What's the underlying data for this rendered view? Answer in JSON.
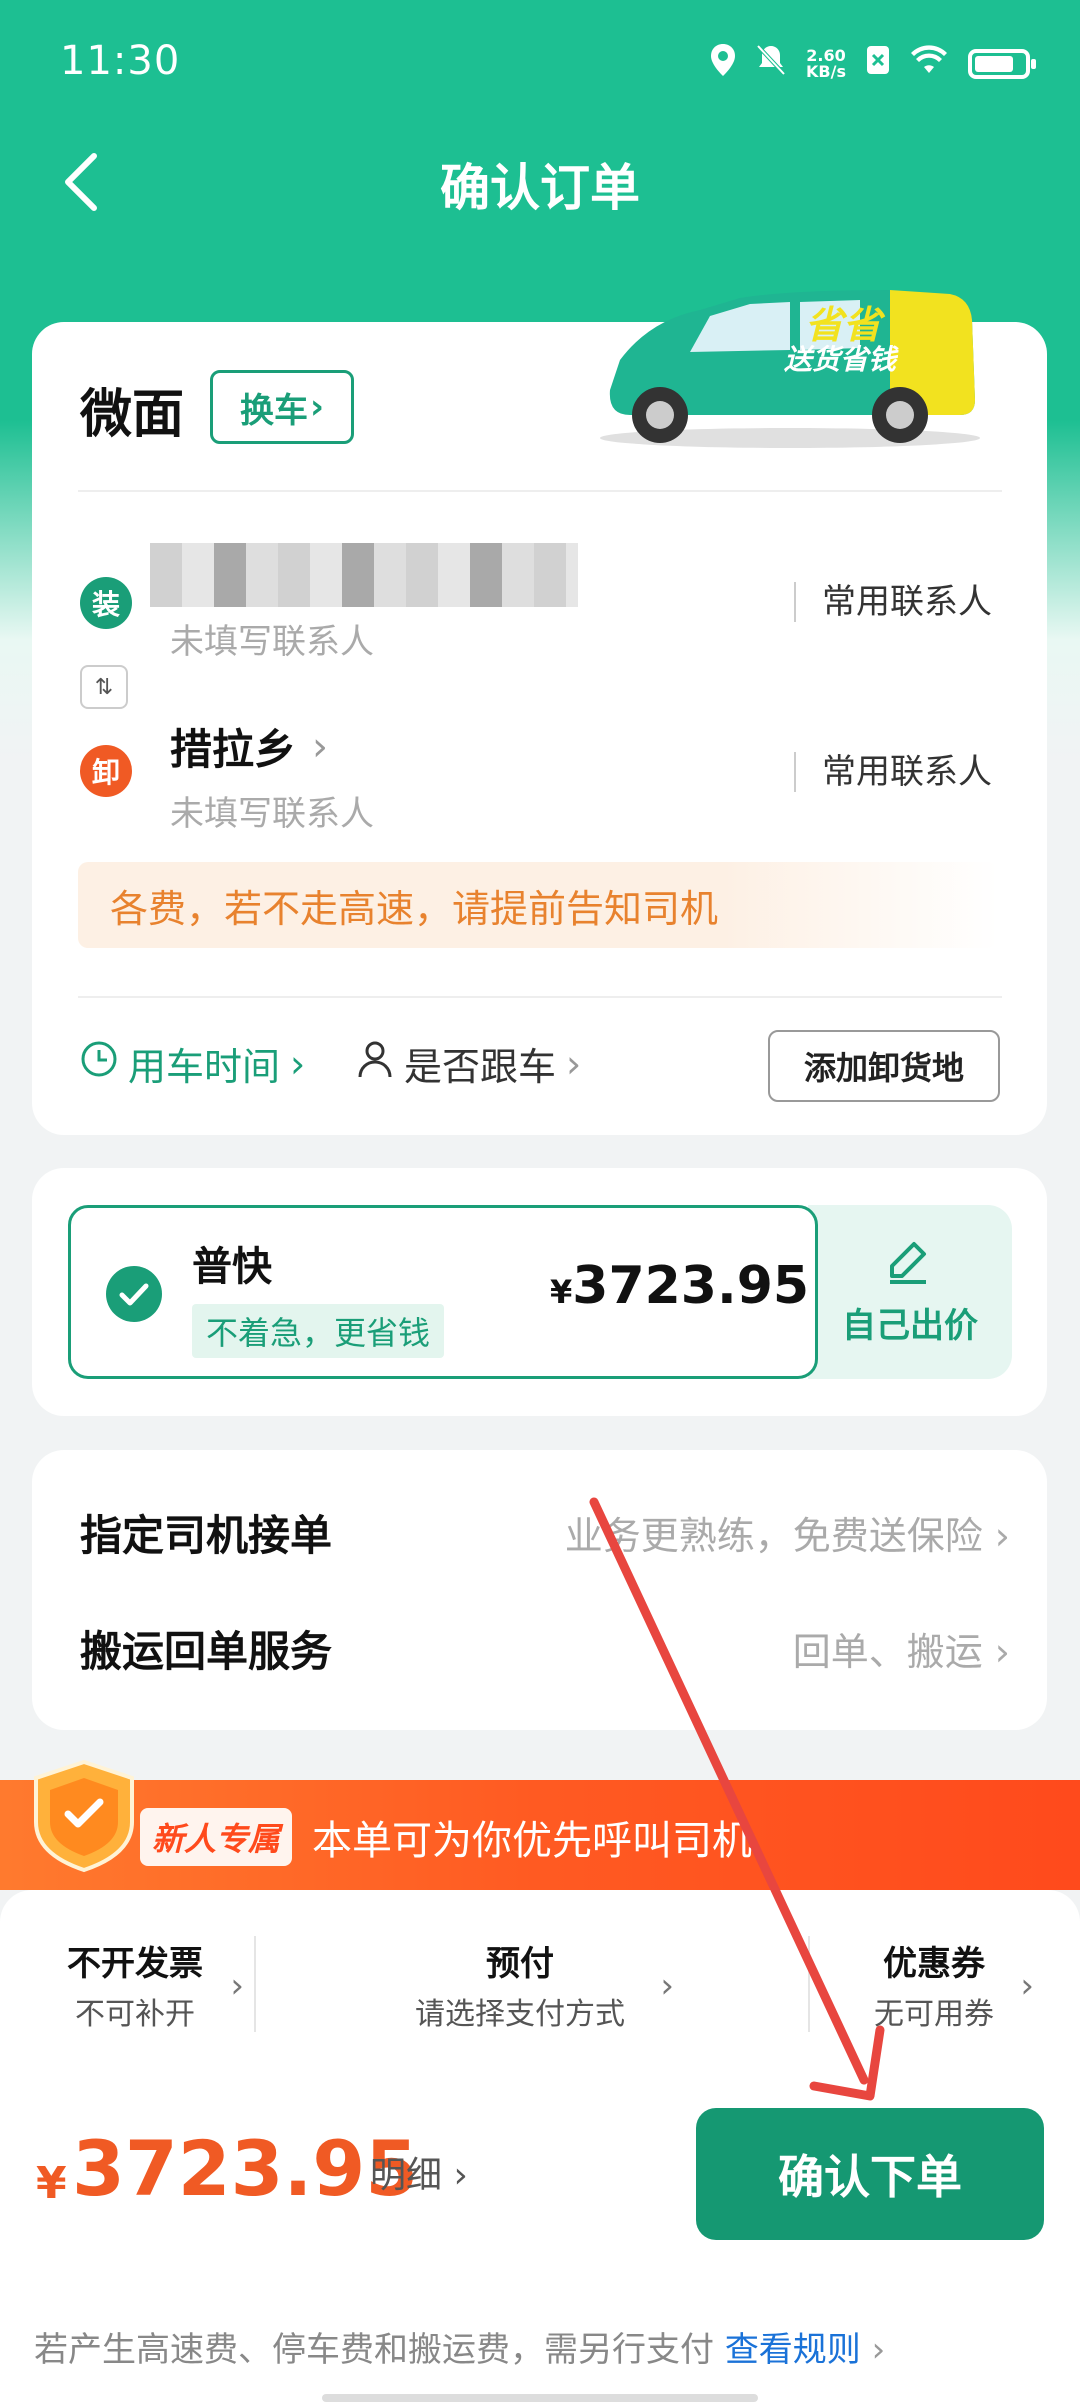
{
  "status_bar": {
    "time": "11:30",
    "net_speed_value": "2.60",
    "net_speed_unit": "KB/s"
  },
  "header": {
    "title": "确认订单"
  },
  "vehicle": {
    "name": "微面",
    "change_label": "换车",
    "promo_img_line1": "省省",
    "promo_img_line2": "送货省钱"
  },
  "route": {
    "load_pin": "装",
    "unload_pin": "卸",
    "load_contact_hint": "未填写联系人",
    "load_contact_link": "常用联系人",
    "unload_address": "措拉乡",
    "unload_contact_hint": "未填写联系人",
    "unload_contact_link": "常用联系人",
    "notice": "各费，若不走高速，请提前告知司机"
  },
  "options": {
    "use_time": "用车时间",
    "follow_car": "是否跟车",
    "add_unload": "添加卸货地"
  },
  "pricing": {
    "fast_name": "普快",
    "fast_tag": "不着急，更省钱",
    "currency": "¥",
    "fast_price": "3723.95",
    "bid_label": "自己出价"
  },
  "services": {
    "assign_driver_title": "指定司机接单",
    "assign_driver_value": "业务更熟练，免费送保险",
    "receipt_title": "搬运回单服务",
    "receipt_value": "回单、搬运"
  },
  "promo": {
    "tag": "新人专属",
    "text": "本单可为你优先呼叫司机"
  },
  "payment": {
    "invoice_title": "不开发票",
    "invoice_sub": "不可补开",
    "prepay_title": "预付",
    "prepay_sub": "请选择支付方式",
    "coupon_title": "优惠券",
    "coupon_sub": "无可用券"
  },
  "checkout": {
    "currency": "¥",
    "total": "3723.95",
    "detail_label": "明细",
    "confirm_label": "确认下单"
  },
  "footer": {
    "note": "若产生高速费、停车费和搬运费，需另行支付",
    "rule_link": "查看规则"
  },
  "colors": {
    "brand_green": "#1a9e78",
    "header_green": "#1dbf92",
    "price_orange": "#f05a24",
    "annotation_red": "#e8463f"
  }
}
